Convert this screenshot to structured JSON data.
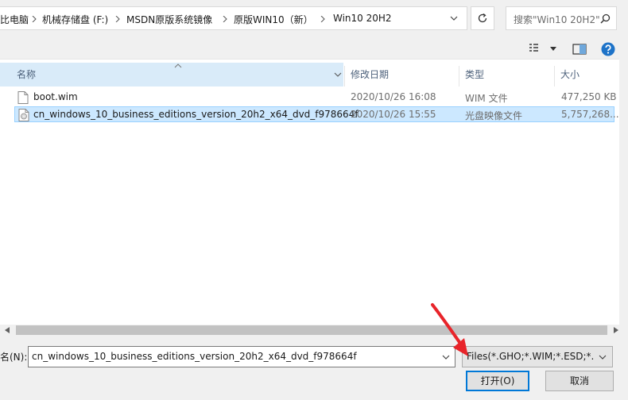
{
  "address": {
    "crumbs": [
      "比电脑",
      "机械存储盘 (F:)",
      "MSDN原版系统镜像",
      "原版WIN10（新）",
      "Win10 20H2"
    ]
  },
  "search": {
    "placeholder": "搜索\"Win10 20H2\""
  },
  "columns": {
    "name": "名称",
    "date": "修改日期",
    "type": "类型",
    "size": "大小"
  },
  "files": [
    {
      "name": "boot.wim",
      "date": "2020/10/26 16:08",
      "type": "WIM 文件",
      "size": "477,250 KB",
      "selected": false
    },
    {
      "name": "cn_windows_10_business_editions_version_20h2_x64_dvd_f978664f",
      "date": "2020/10/26 15:55",
      "type": "光盘映像文件",
      "size": "5,757,268...",
      "selected": true
    }
  ],
  "bottom": {
    "filename_label": "名(N):",
    "filename_value": "cn_windows_10_business_editions_version_20h2_x64_dvd_f978664f",
    "filetype_value": "Files(*.GHO;*.WIM;*.ESD;*.ISO",
    "open_label": "打开(O)",
    "cancel_label": "取消"
  },
  "colors": {
    "selected_row": "#cce8ff",
    "accent": "#0078d7",
    "help": "#1e73c8",
    "arrow": "#e8242a"
  }
}
